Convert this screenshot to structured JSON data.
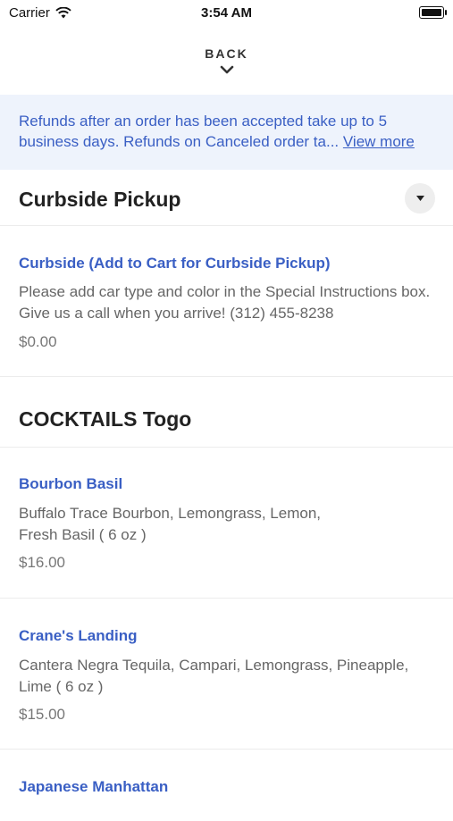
{
  "status": {
    "carrier": "Carrier",
    "time": "3:54 AM"
  },
  "nav": {
    "back_label": "BACK"
  },
  "notice": {
    "text": "Refunds after an order has been accepted take up to 5 business days. Refunds on Canceled order ta...",
    "link": "View more"
  },
  "sections": [
    {
      "title": "Curbside Pickup"
    },
    {
      "title": "COCKTAILS Togo"
    }
  ],
  "items": [
    {
      "name": "Curbside (Add to Cart for Curbside Pickup)",
      "desc": "Please add car type and color in the Special Instructions box. Give us a call when you arrive! (312) 455-8238",
      "price": "$0.00"
    },
    {
      "name": "Bourbon Basil",
      "desc": "Buffalo Trace Bourbon, Lemongrass, Lemon, Fresh Basil ( 6 oz )",
      "price": "$16.00"
    },
    {
      "name": "Crane's Landing",
      "desc": "Cantera Negra Tequila, Campari, Lemongrass, Pineapple, Lime ( 6 oz )",
      "price": "$15.00"
    },
    {
      "name": "Japanese Manhattan"
    }
  ]
}
